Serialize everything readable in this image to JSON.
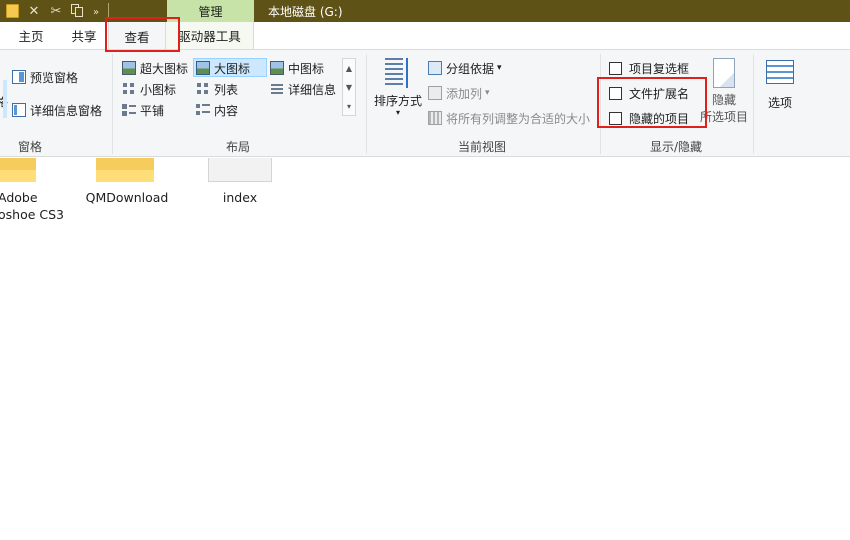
{
  "titlebar": {
    "context_tab": "管理",
    "window_title": "本地磁盘 (G:)",
    "more_label": "»",
    "close_glyph": "✕",
    "cut_glyph": "✂"
  },
  "tabs": [
    {
      "label": "主页"
    },
    {
      "label": "共享"
    },
    {
      "label": "查看"
    },
    {
      "label": "驱动器工具"
    }
  ],
  "ribbon": {
    "panes": {
      "label": "窗格",
      "nav_fragment": "格",
      "preview": "预览窗格",
      "details": "详细信息窗格"
    },
    "layout": {
      "label": "布局",
      "extra_large": "超大图标",
      "large": "大图标",
      "medium": "中图标",
      "small": "小图标",
      "list": "列表",
      "details": "详细信息",
      "tiles": "平铺",
      "content": "内容",
      "scroll_up": "▲",
      "scroll_down": "▼",
      "scroll_more": "▾",
      "selected": "large"
    },
    "current_view": {
      "label": "当前视图",
      "sort": "排序方式",
      "sort_caret": "▾",
      "group": "分组依据",
      "group_caret": "▾",
      "add_column": "添加列",
      "add_caret": "▾",
      "fit_columns": "将所有列调整为合适的大小"
    },
    "show_hide": {
      "label": "显示/隐藏",
      "item_checkboxes": "项目复选框",
      "file_extensions": "文件扩展名",
      "hidden_items": "隐藏的项目",
      "hide_selected_line1": "隐藏",
      "hide_selected_line2": "所选项目",
      "checked": {
        "item_checkboxes": false,
        "file_extensions": false,
        "hidden_items": false
      }
    },
    "options": {
      "label": "选项"
    }
  },
  "files": [
    {
      "line1": "Adobe",
      "line2": "oshoe CS3"
    },
    {
      "line1": "QMDownload"
    },
    {
      "line1": "index"
    }
  ],
  "colors": {
    "titlebar": "#5f5216",
    "context_tab": "#c7e3a7",
    "highlight_box": "#e0211b",
    "selection": "#cce8ff"
  }
}
